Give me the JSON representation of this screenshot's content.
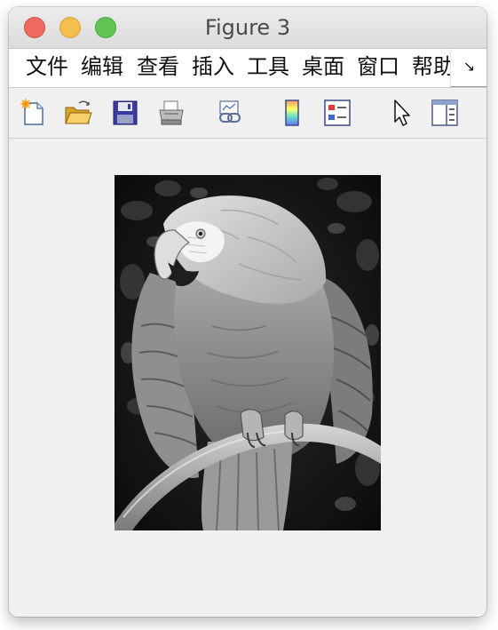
{
  "window": {
    "title": "Figure 3",
    "traffic_lights": {
      "close": "#ee6a5e",
      "minimize": "#f5bf4f",
      "zoom": "#61c554"
    }
  },
  "menubar": {
    "items": [
      {
        "label": "文件"
      },
      {
        "label": "编辑"
      },
      {
        "label": "查看"
      },
      {
        "label": "插入"
      },
      {
        "label": "工具"
      },
      {
        "label": "桌面"
      },
      {
        "label": "窗口"
      },
      {
        "label": "帮助"
      }
    ],
    "overflow_label": "↘"
  },
  "toolbar": {
    "tools": [
      {
        "icon": "new-figure-icon"
      },
      {
        "icon": "open-file-icon"
      },
      {
        "icon": "save-figure-icon"
      },
      {
        "icon": "print-figure-icon"
      },
      {
        "icon": "link-plot-icon"
      },
      {
        "icon": "insert-colorbar-icon"
      },
      {
        "icon": "insert-legend-icon"
      },
      {
        "icon": "edit-plot-icon"
      },
      {
        "icon": "property-inspector-icon"
      }
    ]
  },
  "figure": {
    "image": {
      "subject": "grayscale parrot photograph",
      "colormap": "gray"
    }
  }
}
